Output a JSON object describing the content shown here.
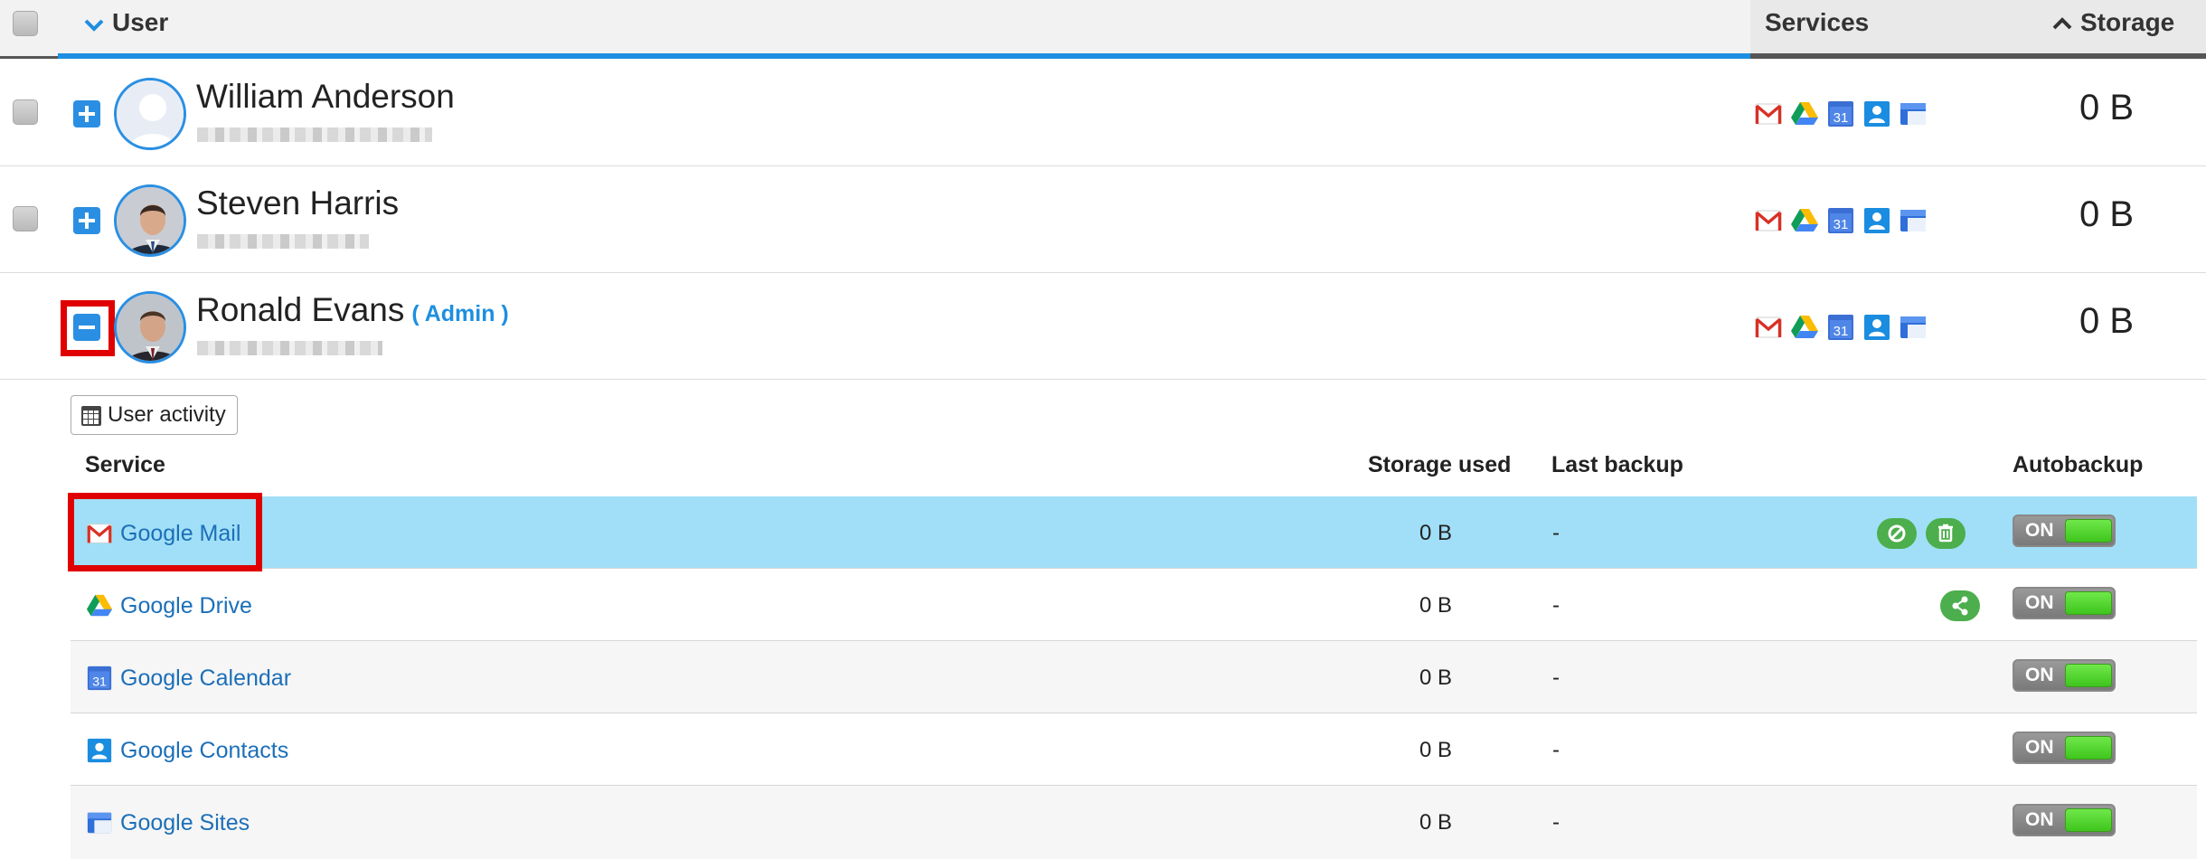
{
  "header": {
    "user_label": "User",
    "services_label": "Services",
    "storage_label": "Storage"
  },
  "users": [
    {
      "name": "William Anderson",
      "admin_label": "",
      "storage": "0 B",
      "expanded": false
    },
    {
      "name": "Steven Harris",
      "admin_label": "",
      "storage": "0 B",
      "expanded": false
    },
    {
      "name": "Ronald Evans",
      "admin_label": "( Admin )",
      "storage": "0 B",
      "expanded": true
    }
  ],
  "detail": {
    "activity_button": "User activity",
    "columns": {
      "service": "Service",
      "storage_used": "Storage used",
      "last_backup": "Last backup",
      "autobackup": "Autobackup"
    },
    "services": [
      {
        "name": "Google Mail",
        "icon": "gmail-icon",
        "storage_used": "0 B",
        "last_backup": "-",
        "autobackup": "ON"
      },
      {
        "name": "Google Drive",
        "icon": "google-drive-icon",
        "storage_used": "0 B",
        "last_backup": "-",
        "autobackup": "ON"
      },
      {
        "name": "Google Calendar",
        "icon": "google-calendar-icon",
        "storage_used": "0 B",
        "last_backup": "-",
        "autobackup": "ON"
      },
      {
        "name": "Google Contacts",
        "icon": "google-contacts-icon",
        "storage_used": "0 B",
        "last_backup": "-",
        "autobackup": "ON"
      },
      {
        "name": "Google Sites",
        "icon": "google-sites-icon",
        "storage_used": "0 B",
        "last_backup": "-",
        "autobackup": "ON"
      }
    ],
    "calendar_icon_day": "31"
  },
  "colors": {
    "accent": "#1e8fe0",
    "selected_row": "#a0dff7",
    "highlight_box": "#e00000",
    "action_green": "#4cae4c",
    "toggle_on": "#3fc51d"
  }
}
